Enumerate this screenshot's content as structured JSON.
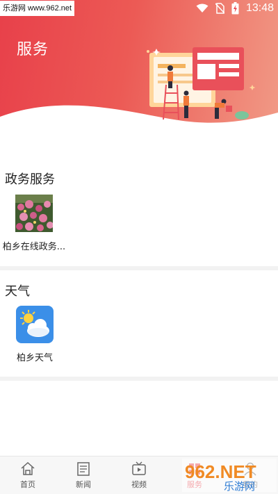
{
  "status_bar": {
    "watermark_text": "乐游网 www.962.net",
    "time": "13:48"
  },
  "header": {
    "title": "服务"
  },
  "sections": [
    {
      "title": "政务服务",
      "apps": [
        {
          "label": "柏乡在线政务...",
          "icon": "flower-photo-icon"
        }
      ]
    },
    {
      "title": "天气",
      "apps": [
        {
          "label": "柏乡天气",
          "icon": "weather-sun-cloud-icon"
        }
      ]
    }
  ],
  "bottom_nav": {
    "items": [
      {
        "label": "首页",
        "icon": "home-icon"
      },
      {
        "label": "新闻",
        "icon": "news-icon"
      },
      {
        "label": "视频",
        "icon": "video-tv-icon"
      },
      {
        "label": "服务",
        "icon": "service-icon"
      },
      {
        "label": "我的",
        "icon": "profile-icon"
      }
    ]
  },
  "watermark": {
    "brand": "962.NET",
    "brand_cn": "乐游网"
  },
  "colors": {
    "header_gradient_start": "#e8404a",
    "header_gradient_end": "#f19a86",
    "weather_icon_bg": "#3b8fe8",
    "divider": "#f2f2f2"
  }
}
